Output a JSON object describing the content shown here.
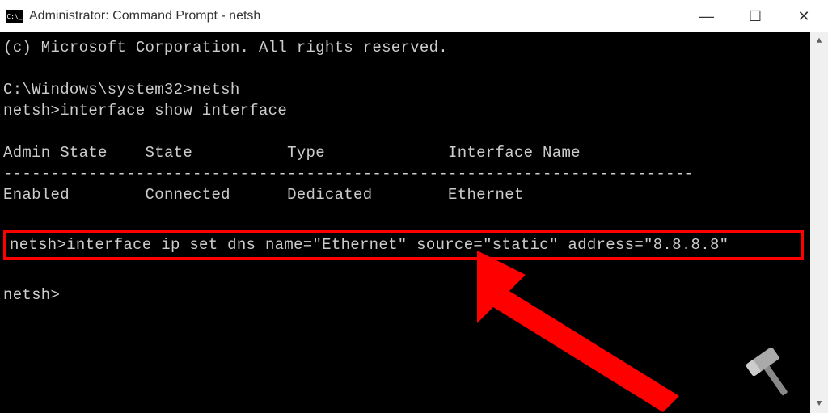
{
  "titlebar": {
    "title": "Administrator: Command Prompt - netsh"
  },
  "controls": {
    "minimize": "—",
    "maximize": "☐",
    "close": "✕"
  },
  "terminal": {
    "copyright": "(c) Microsoft Corporation. All rights reserved.",
    "line1_prompt": "C:\\Windows\\system32>",
    "line1_cmd": "netsh",
    "line2_prompt": "netsh>",
    "line2_cmd": "interface show interface",
    "header_admin": "Admin State",
    "header_state": "State",
    "header_type": "Type",
    "header_iface": "Interface Name",
    "separator": "-------------------------------------------------------------------------",
    "row_admin": "Enabled",
    "row_state": "Connected",
    "row_type": "Dedicated",
    "row_iface": "Ethernet",
    "highlight_prompt": "netsh>",
    "highlight_cmd": "interface ip set dns name=\"Ethernet\" source=\"static\" address=\"8.8.8.8\"",
    "final_prompt": "netsh>"
  },
  "scrollbar": {
    "up": "▲",
    "down": "▼"
  }
}
